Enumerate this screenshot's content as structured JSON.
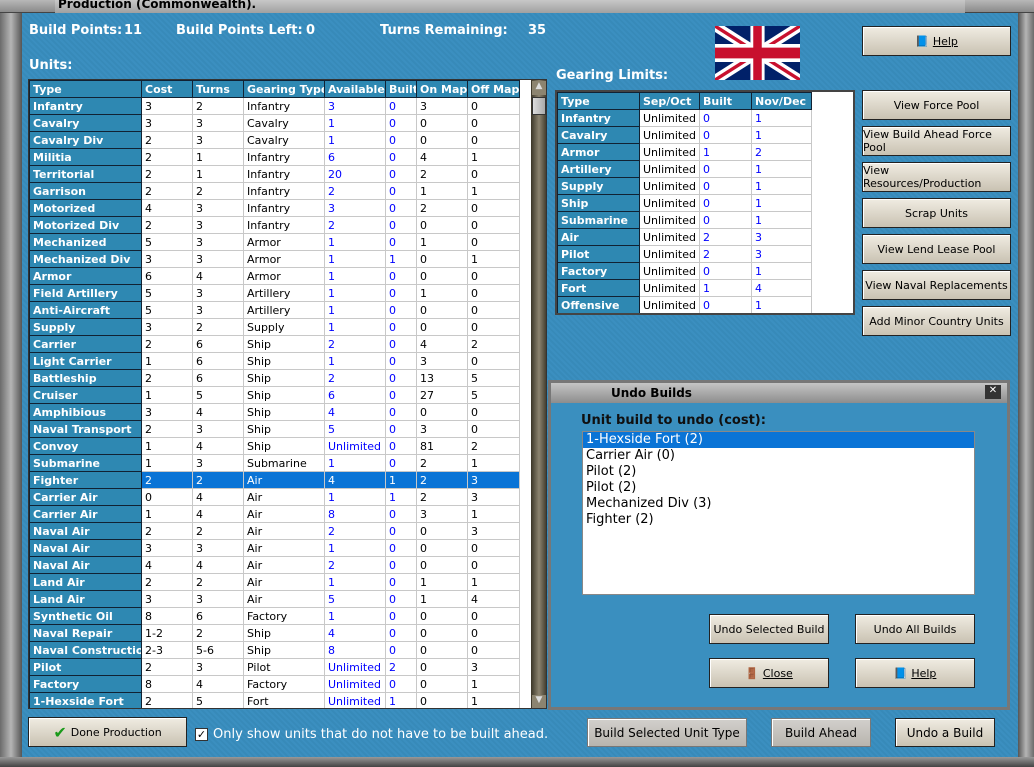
{
  "window": {
    "title": "Production (Commonwealth)."
  },
  "status": {
    "build_points_label": "Build Points:",
    "build_points": "11",
    "build_points_left_label": "Build Points Left:",
    "build_points_left": "0",
    "turns_remaining_label": "Turns Remaining:",
    "turns_remaining": "35"
  },
  "units": {
    "label": "Units:",
    "columns": [
      "Type",
      "Cost",
      "Turns",
      "Gearing Type",
      "Available",
      "Built",
      "On Map",
      "Off Map"
    ],
    "rows": [
      [
        "Infantry",
        "3",
        "2",
        "Infantry",
        "3",
        "0",
        "3",
        "0"
      ],
      [
        "Cavalry",
        "3",
        "3",
        "Cavalry",
        "1",
        "0",
        "0",
        "0"
      ],
      [
        "Cavalry Div",
        "2",
        "3",
        "Cavalry",
        "1",
        "0",
        "0",
        "0"
      ],
      [
        "Militia",
        "2",
        "1",
        "Infantry",
        "6",
        "0",
        "4",
        "1"
      ],
      [
        "Territorial",
        "2",
        "1",
        "Infantry",
        "20",
        "0",
        "2",
        "0"
      ],
      [
        "Garrison",
        "2",
        "2",
        "Infantry",
        "2",
        "0",
        "1",
        "1"
      ],
      [
        "Motorized",
        "4",
        "3",
        "Infantry",
        "3",
        "0",
        "2",
        "0"
      ],
      [
        "Motorized Div",
        "2",
        "3",
        "Infantry",
        "2",
        "0",
        "0",
        "0"
      ],
      [
        "Mechanized",
        "5",
        "3",
        "Armor",
        "1",
        "0",
        "1",
        "0"
      ],
      [
        "Mechanized Div",
        "3",
        "3",
        "Armor",
        "1",
        "1",
        "0",
        "1"
      ],
      [
        "Armor",
        "6",
        "4",
        "Armor",
        "1",
        "0",
        "0",
        "0"
      ],
      [
        "Field Artillery",
        "5",
        "3",
        "Artillery",
        "1",
        "0",
        "1",
        "0"
      ],
      [
        "Anti-Aircraft",
        "5",
        "3",
        "Artillery",
        "1",
        "0",
        "0",
        "0"
      ],
      [
        "Supply",
        "3",
        "2",
        "Supply",
        "1",
        "0",
        "0",
        "0"
      ],
      [
        "Carrier",
        "2",
        "6",
        "Ship",
        "2",
        "0",
        "4",
        "2"
      ],
      [
        "Light Carrier",
        "1",
        "6",
        "Ship",
        "1",
        "0",
        "3",
        "0"
      ],
      [
        "Battleship",
        "2",
        "6",
        "Ship",
        "2",
        "0",
        "13",
        "5"
      ],
      [
        "Cruiser",
        "1",
        "5",
        "Ship",
        "6",
        "0",
        "27",
        "5"
      ],
      [
        "Amphibious",
        "3",
        "4",
        "Ship",
        "4",
        "0",
        "0",
        "0"
      ],
      [
        "Naval Transport",
        "2",
        "3",
        "Ship",
        "5",
        "0",
        "3",
        "0"
      ],
      [
        "Convoy",
        "1",
        "4",
        "Ship",
        "Unlimited",
        "0",
        "81",
        "2"
      ],
      [
        "Submarine",
        "1",
        "3",
        "Submarine",
        "1",
        "0",
        "2",
        "1"
      ],
      [
        "Fighter",
        "2",
        "2",
        "Air",
        "4",
        "1",
        "2",
        "3"
      ],
      [
        "Carrier Air",
        "0",
        "4",
        "Air",
        "1",
        "1",
        "2",
        "3"
      ],
      [
        "Carrier Air",
        "1",
        "4",
        "Air",
        "8",
        "0",
        "3",
        "1"
      ],
      [
        "Naval Air",
        "2",
        "2",
        "Air",
        "2",
        "0",
        "0",
        "3"
      ],
      [
        "Naval Air",
        "3",
        "3",
        "Air",
        "1",
        "0",
        "0",
        "0"
      ],
      [
        "Naval Air",
        "4",
        "4",
        "Air",
        "2",
        "0",
        "0",
        "0"
      ],
      [
        "Land Air",
        "2",
        "2",
        "Air",
        "1",
        "0",
        "1",
        "1"
      ],
      [
        "Land Air",
        "3",
        "3",
        "Air",
        "5",
        "0",
        "1",
        "4"
      ],
      [
        "Synthetic Oil",
        "8",
        "6",
        "Factory",
        "1",
        "0",
        "0",
        "0"
      ],
      [
        "Naval Repair",
        "1-2",
        "2",
        "Ship",
        "4",
        "0",
        "0",
        "0"
      ],
      [
        "Naval Construction",
        "2-3",
        "5-6",
        "Ship",
        "8",
        "0",
        "0",
        "0"
      ],
      [
        "Pilot",
        "2",
        "3",
        "Pilot",
        "Unlimited",
        "2",
        "0",
        "3"
      ],
      [
        "Factory",
        "8",
        "4",
        "Factory",
        "Unlimited",
        "0",
        "0",
        "1"
      ],
      [
        "1-Hexside Fort",
        "2",
        "5",
        "Fort",
        "Unlimited",
        "1",
        "0",
        "1"
      ]
    ],
    "selected_row": "Fighter"
  },
  "gearing": {
    "label": "Gearing Limits:",
    "columns": [
      "Type",
      "Sep/Oct",
      "Built",
      "Nov/Dec"
    ],
    "rows": [
      [
        "Infantry",
        "Unlimited",
        "0",
        "1"
      ],
      [
        "Cavalry",
        "Unlimited",
        "0",
        "1"
      ],
      [
        "Armor",
        "Unlimited",
        "1",
        "2"
      ],
      [
        "Artillery",
        "Unlimited",
        "0",
        "1"
      ],
      [
        "Supply",
        "Unlimited",
        "0",
        "1"
      ],
      [
        "Ship",
        "Unlimited",
        "0",
        "1"
      ],
      [
        "Submarine",
        "Unlimited",
        "0",
        "1"
      ],
      [
        "Air",
        "Unlimited",
        "2",
        "3"
      ],
      [
        "Pilot",
        "Unlimited",
        "2",
        "3"
      ],
      [
        "Factory",
        "Unlimited",
        "0",
        "1"
      ],
      [
        "Fort",
        "Unlimited",
        "1",
        "4"
      ],
      [
        "Offensive",
        "Unlimited",
        "0",
        "1"
      ]
    ]
  },
  "side_buttons": {
    "help": "Help",
    "items": [
      "View Force Pool",
      "View Build Ahead Force Pool",
      "View Resources/Production",
      "Scrap Units",
      "View Lend Lease Pool",
      "View Naval Replacements",
      "Add Minor Country Units"
    ]
  },
  "undo_dialog": {
    "title": "Undo Builds",
    "label": "Unit build to undo (cost):",
    "items": [
      "1-Hexside Fort (2)",
      "Carrier Air (0)",
      "Pilot (2)",
      "Pilot (2)",
      "Mechanized Div (3)",
      "Fighter (2)"
    ],
    "selected": "1-Hexside Fort (2)",
    "undo_selected": "Undo Selected Build",
    "undo_all": "Undo All Builds",
    "close": "Close",
    "help": "Help"
  },
  "bottom": {
    "done": "Done Production",
    "checkbox_label": "Only show units that do not have to be built ahead.",
    "checkbox_checked": true,
    "build_selected": "Build Selected Unit Type",
    "build_ahead": "Build Ahead",
    "undo_build": "Undo a Build"
  },
  "colors": {
    "background": "#3a8fbf",
    "header": "#2e88b2",
    "selection": "#0a74d6",
    "value_blue": "#0000ff"
  },
  "flag": {
    "icon": "union-jack-flag"
  }
}
